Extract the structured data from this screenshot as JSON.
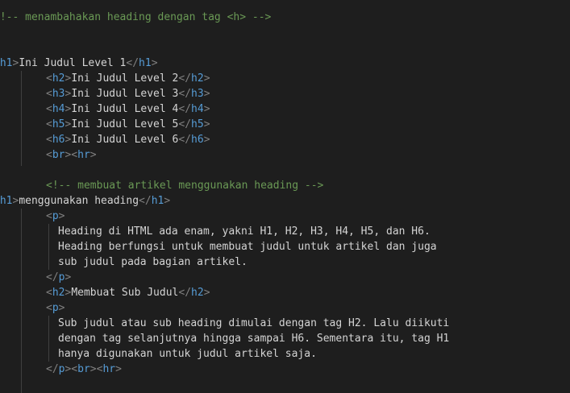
{
  "editor": {
    "colors": {
      "background": "#1e1e1e",
      "comment": "#6a9955",
      "bracket": "#808080",
      "tag": "#569cd6",
      "text": "#d4d4d4",
      "indent_guide": "#404040"
    },
    "lines": [
      {
        "tokens": [
          {
            "t": "comment",
            "v": "<!-- menambahakan heading dengan tag <h> -->"
          }
        ]
      },
      {
        "tokens": [
          {
            "t": "bracket",
            "v": "<"
          },
          {
            "t": "tag",
            "v": "h1"
          },
          {
            "t": "bracket",
            "v": ">"
          },
          {
            "t": "text",
            "v": "Ini Judul Level 1"
          },
          {
            "t": "bracket",
            "v": "</"
          },
          {
            "t": "tag",
            "v": "h1"
          },
          {
            "t": "bracket",
            "v": ">"
          }
        ]
      },
      {
        "tokens": [
          {
            "t": "bracket",
            "v": "<"
          },
          {
            "t": "tag",
            "v": "h2"
          },
          {
            "t": "bracket",
            "v": ">"
          },
          {
            "t": "text",
            "v": "Ini Judul Level 2"
          },
          {
            "t": "bracket",
            "v": "</"
          },
          {
            "t": "tag",
            "v": "h2"
          },
          {
            "t": "bracket",
            "v": ">"
          }
        ]
      },
      {
        "tokens": [
          {
            "t": "bracket",
            "v": "<"
          },
          {
            "t": "tag",
            "v": "h3"
          },
          {
            "t": "bracket",
            "v": ">"
          },
          {
            "t": "text",
            "v": "Ini Judul Level 3"
          },
          {
            "t": "bracket",
            "v": "</"
          },
          {
            "t": "tag",
            "v": "h3"
          },
          {
            "t": "bracket",
            "v": ">"
          }
        ]
      },
      {
        "tokens": [
          {
            "t": "bracket",
            "v": "<"
          },
          {
            "t": "tag",
            "v": "h4"
          },
          {
            "t": "bracket",
            "v": ">"
          },
          {
            "t": "text",
            "v": "Ini Judul Level 4"
          },
          {
            "t": "bracket",
            "v": "</"
          },
          {
            "t": "tag",
            "v": "h4"
          },
          {
            "t": "bracket",
            "v": ">"
          }
        ]
      },
      {
        "tokens": [
          {
            "t": "bracket",
            "v": "<"
          },
          {
            "t": "tag",
            "v": "h5"
          },
          {
            "t": "bracket",
            "v": ">"
          },
          {
            "t": "text",
            "v": "Ini Judul Level 5"
          },
          {
            "t": "bracket",
            "v": "</"
          },
          {
            "t": "tag",
            "v": "h5"
          },
          {
            "t": "bracket",
            "v": ">"
          }
        ]
      },
      {
        "tokens": [
          {
            "t": "bracket",
            "v": "<"
          },
          {
            "t": "tag",
            "v": "h6"
          },
          {
            "t": "bracket",
            "v": ">"
          },
          {
            "t": "text",
            "v": "Ini Judul Level 6"
          },
          {
            "t": "bracket",
            "v": "</"
          },
          {
            "t": "tag",
            "v": "h6"
          },
          {
            "t": "bracket",
            "v": ">"
          }
        ]
      },
      {
        "tokens": [
          {
            "t": "bracket",
            "v": "<"
          },
          {
            "t": "tag",
            "v": "br"
          },
          {
            "t": "bracket",
            "v": "><"
          },
          {
            "t": "tag",
            "v": "hr"
          },
          {
            "t": "bracket",
            "v": ">"
          }
        ]
      },
      {
        "tokens": [
          {
            "t": "comment",
            "v": "<!-- membuat artikel menggunakan heading -->"
          }
        ]
      },
      {
        "tokens": [
          {
            "t": "bracket",
            "v": "<"
          },
          {
            "t": "tag",
            "v": "h1"
          },
          {
            "t": "bracket",
            "v": ">"
          },
          {
            "t": "text",
            "v": "menggunakan heading"
          },
          {
            "t": "bracket",
            "v": "</"
          },
          {
            "t": "tag",
            "v": "h1"
          },
          {
            "t": "bracket",
            "v": ">"
          }
        ]
      },
      {
        "tokens": [
          {
            "t": "bracket",
            "v": "<"
          },
          {
            "t": "tag",
            "v": "p"
          },
          {
            "t": "bracket",
            "v": ">"
          }
        ]
      },
      {
        "tokens": [
          {
            "t": "text",
            "v": "Heading di HTML ada enam, yakni H1, H2, H3, H4, H5, dan H6."
          }
        ]
      },
      {
        "tokens": [
          {
            "t": "text",
            "v": "Heading berfungsi untuk membuat judul untuk artikel dan juga"
          }
        ]
      },
      {
        "tokens": [
          {
            "t": "text",
            "v": "sub judul pada bagian artikel."
          }
        ]
      },
      {
        "tokens": [
          {
            "t": "bracket",
            "v": "</"
          },
          {
            "t": "tag",
            "v": "p"
          },
          {
            "t": "bracket",
            "v": ">"
          }
        ]
      },
      {
        "tokens": [
          {
            "t": "bracket",
            "v": "<"
          },
          {
            "t": "tag",
            "v": "h2"
          },
          {
            "t": "bracket",
            "v": ">"
          },
          {
            "t": "text",
            "v": "Membuat Sub Judul"
          },
          {
            "t": "bracket",
            "v": "</"
          },
          {
            "t": "tag",
            "v": "h2"
          },
          {
            "t": "bracket",
            "v": ">"
          }
        ]
      },
      {
        "tokens": [
          {
            "t": "bracket",
            "v": "<"
          },
          {
            "t": "tag",
            "v": "p"
          },
          {
            "t": "bracket",
            "v": ">"
          }
        ]
      },
      {
        "tokens": [
          {
            "t": "text",
            "v": "Sub judul atau sub heading dimulai dengan tag H2. Lalu diikuti"
          }
        ]
      },
      {
        "tokens": [
          {
            "t": "text",
            "v": "dengan tag selanjutnya hingga sampai H6. Sementara itu, tag H1"
          }
        ]
      },
      {
        "tokens": [
          {
            "t": "text",
            "v": "hanya digunakan untuk judul artikel saja."
          }
        ]
      },
      {
        "tokens": [
          {
            "t": "bracket",
            "v": "</"
          },
          {
            "t": "tag",
            "v": "p"
          },
          {
            "t": "bracket",
            "v": "><"
          },
          {
            "t": "tag",
            "v": "br"
          },
          {
            "t": "bracket",
            "v": "><"
          },
          {
            "t": "tag",
            "v": "hr"
          },
          {
            "t": "bracket",
            "v": ">"
          }
        ]
      }
    ]
  }
}
